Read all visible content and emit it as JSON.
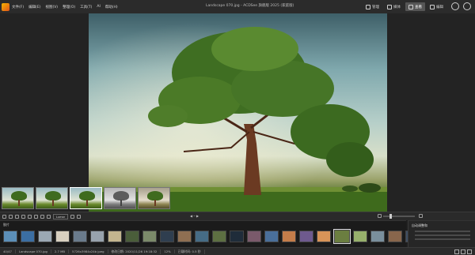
{
  "menu": [
    "文件(F)",
    "编辑(E)",
    "视图(V)",
    "整理(O)",
    "工具(T)",
    "AI",
    "帮助(H)"
  ],
  "window_title": "Landscape 070.jpg - ACDSee 旗舰版 2025 (家庭版)",
  "modes": [
    {
      "label": "管理",
      "icon": "grid-icon"
    },
    {
      "label": "媒体",
      "icon": "folder-icon"
    },
    {
      "label": "查看",
      "icon": "eye-icon",
      "active": true
    },
    {
      "label": "编辑",
      "icon": "brush-icon"
    }
  ],
  "toolbar": {
    "nav_label": "◀ ─ ▶",
    "mode_button": "Lumar"
  },
  "presets": [
    {
      "name": "preset-original",
      "style": "normal"
    },
    {
      "name": "preset-vivid",
      "style": "normal"
    },
    {
      "name": "preset-bright",
      "style": "normal",
      "active": true
    },
    {
      "name": "preset-bw",
      "style": "bw"
    },
    {
      "name": "preset-warm",
      "style": "warm"
    }
  ],
  "filmstrip": {
    "label": "胶片",
    "thumbs": [
      "#5c8fb8",
      "#3b6ea2",
      "#9ba8b3",
      "#d8d0c0",
      "#6a7b8c",
      "#98a2ad",
      "#c3b58f",
      "#4a5d3a",
      "#7b8a6a",
      "#2f3e4f",
      "#8f6f52",
      "#466c86",
      "#5d6f42",
      "#1f2c3a",
      "#7a5a6b",
      "#4a6f9a",
      "#c47d4a",
      "#6e5a8e",
      "#d89458",
      "#6b7e40",
      "#97b06c",
      "#7a8f9c",
      "#88664c",
      "#3e4e62",
      "#5e8a3c",
      "#cfd7e6",
      "#b06a49"
    ]
  },
  "info_panel": {
    "title": "自动调整和"
  },
  "status": {
    "index": "40/47",
    "file": "Landscape 070.jpg",
    "size": "2.7 MB",
    "dims": "5726x3984x24b jpeg",
    "modified": "修改日期: 2020/11/26 19:18:32",
    "zoom": "12%",
    "load": "已载时间: 0.5 秒"
  }
}
